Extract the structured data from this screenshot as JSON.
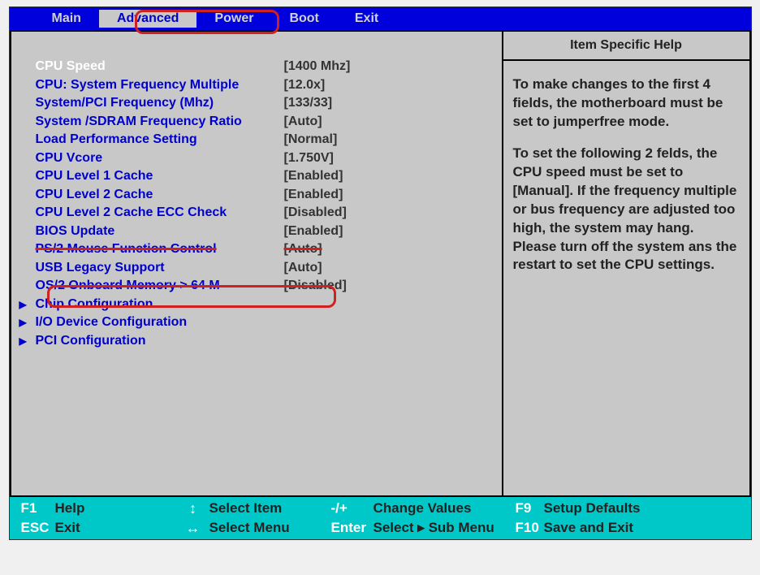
{
  "menu": {
    "items": [
      "Main",
      "Advanced",
      "Power",
      "Boot",
      "Exit"
    ],
    "activeIndex": 1
  },
  "settings": [
    {
      "label": "CPU Speed",
      "value": "[1400 Mhz]",
      "current": true
    },
    {
      "label": "CPU: System Frequency Multiple",
      "value": "[12.0x]"
    },
    {
      "label": "System/PCI Frequency (Mhz)",
      "value": "[133/33]"
    },
    {
      "label": "System /SDRAM Frequency Ratio",
      "value": "[Auto]"
    },
    {
      "label": "Load Performance Setting",
      "value": "[Normal]"
    },
    {
      "label": "CPU Vcore",
      "value": "[1.750V]"
    },
    {
      "label": "CPU Level 1 Cache",
      "value": "[Enabled]"
    },
    {
      "label": "CPU Level 2 Cache",
      "value": "[Enabled]"
    },
    {
      "label": "CPU Level 2 Cache ECC Check",
      "value": "[Disabled]"
    },
    {
      "label": "BIOS Update",
      "value": "[Enabled]"
    },
    {
      "label": "PS/2 Mouse Function Control",
      "value": "[Auto]",
      "strike": true
    },
    {
      "label": "USB Legacy Support",
      "value": "[Auto]"
    },
    {
      "label": "OS/2 Onboard Memory > 64 M",
      "value": "[Disabled]"
    }
  ],
  "submenus": [
    "Chip Configuration",
    "I/O Device Configuration",
    "PCI Configuration"
  ],
  "help": {
    "title": "Item Specific Help",
    "p1": "To make changes to the first 4 fields, the motherboard must be set to jumperfree mode.",
    "p2": "To set the following 2 felds, the CPU speed must be set to [Manual]. If the frequency multiple or bus frequency are adjusted too high, the system may hang. Please turn off the system ans the restart to set the CPU settings."
  },
  "footer": {
    "r1": {
      "k1": "F1",
      "l1": "Help",
      "i1": "↕",
      "m1": "Select Item",
      "k2": "-/+",
      "v2": "Change Values",
      "k3": "F9",
      "l3": "Setup Defaults"
    },
    "r2": {
      "k1": "ESC",
      "l1": "Exit",
      "i1": "↔",
      "m1": "Select Menu",
      "k2": "Enter",
      "v2": "Select ▸ Sub Menu",
      "k3": "F10",
      "l3": "Save and Exit"
    }
  }
}
